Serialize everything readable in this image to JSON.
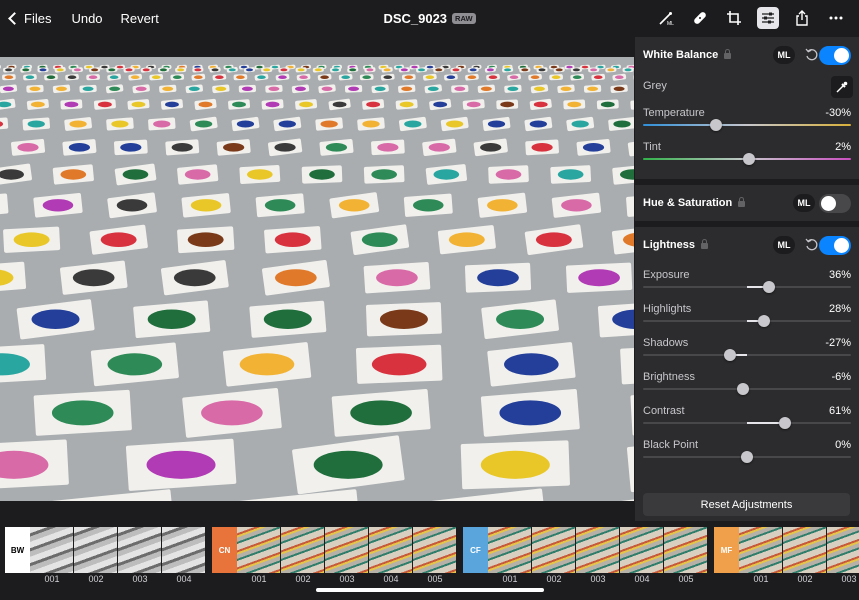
{
  "header": {
    "back_label": "Files",
    "undo_label": "Undo",
    "revert_label": "Revert",
    "title": "DSC_9023",
    "format_badge": "RAW",
    "tools": [
      "ml-mask-icon",
      "heal-icon",
      "crop-icon",
      "adjust-icon",
      "share-icon",
      "more-icon"
    ],
    "active_tool": "adjust-icon"
  },
  "panel": {
    "white_balance": {
      "title": "White Balance",
      "ml": "ML",
      "enabled": true,
      "grey_label": "Grey",
      "temperature": {
        "label": "Temperature",
        "value": "-30%",
        "level": 0.35
      },
      "tint": {
        "label": "Tint",
        "value": "2%",
        "level": 0.51
      }
    },
    "hue_saturation": {
      "title": "Hue & Saturation",
      "ml": "ML",
      "enabled": false
    },
    "lightness": {
      "title": "Lightness",
      "ml": "ML",
      "enabled": true,
      "sliders": [
        {
          "label": "Exposure",
          "value": "36%",
          "level": 0.36
        },
        {
          "label": "Highlights",
          "value": "28%",
          "level": 0.28
        },
        {
          "label": "Shadows",
          "value": "-27%",
          "level": -0.27
        },
        {
          "label": "Brightness",
          "value": "-6%",
          "level": -0.06
        },
        {
          "label": "Contrast",
          "value": "61%",
          "level": 0.61
        },
        {
          "label": "Black Point",
          "value": "0%",
          "level": 0
        }
      ]
    },
    "reset_label": "Reset Adjustments"
  },
  "filmstrip": {
    "groups": [
      {
        "tag": "BW",
        "color": "#ffffff",
        "text_color": "#000000",
        "thumbs": [
          "001",
          "002",
          "003",
          "004"
        ],
        "mono": true
      },
      {
        "tag": "CN",
        "color": "#e8743b",
        "text_color": "#ffffff",
        "thumbs": [
          "001",
          "002",
          "003",
          "004",
          "005"
        ],
        "mono": false
      },
      {
        "tag": "CF",
        "color": "#5aa6dc",
        "text_color": "#ffffff",
        "thumbs": [
          "001",
          "002",
          "003",
          "004",
          "005"
        ],
        "mono": false
      },
      {
        "tag": "MF",
        "color": "#f0a04b",
        "text_color": "#ffffff",
        "thumbs": [
          "001",
          "002",
          "003"
        ],
        "mono": false
      }
    ]
  }
}
